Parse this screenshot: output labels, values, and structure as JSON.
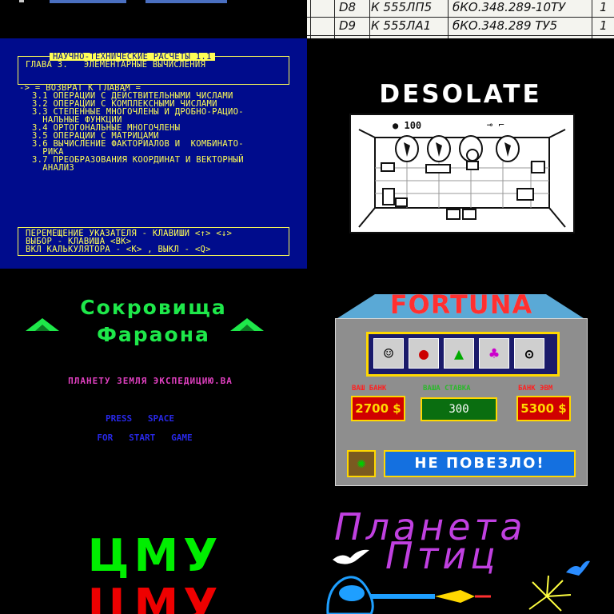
{
  "colors": {
    "calc_bg": "#000c8c",
    "calc_fg": "#ffff55",
    "pharaoh_green": "#1ee84a",
    "magenta": "#e040c0",
    "blue": "#2828e8",
    "fortuna_red": "#ff3030",
    "cmu_green": "#00ee00",
    "cmu_red": "#ee0000",
    "birds_magenta": "#c040e0"
  },
  "table_scan": {
    "rows": [
      {
        "ref": "D8",
        "part": "К 555ЛП5",
        "doc": "бКО.348.289-10ТУ",
        "qty": "1"
      },
      {
        "ref": "D9",
        "part": "К 555ЛА1",
        "doc": "бКО.348.289 ТУ5",
        "qty": "1"
      }
    ]
  },
  "calc_menu": {
    "title": "НАУЧНО-ТЕХНИЧЕСКИЕ РАСЧЕТЫ 1.1",
    "chapter": "ГЛАВА 3.   ЭЛЕМЕНТАРНЫЕ ВЫЧИСЛЕНИЯ",
    "back_item": "-> = ВОЗВРАТ К ГЛАВАМ =",
    "items": [
      "3.1 ОПЕРАЦИИ С ДЕЙСТВИТЕЛЬНЫМИ ЧИСЛАМИ",
      "3.2 ОПЕРАЦИИ С КОМПЛЕКСНЫМИ ЧИСЛАМИ",
      "3.3 СТЕПЕННЫЕ МНОГОЧЛЕНЫ И ДРОБНО-РАЦИО-\n  НАЛЬНЫЕ ФУНКЦИИ",
      "3.4 ОРТОГОНАЛЬНЫЕ МНОГОЧЛЕНЫ",
      "3.5 ОПЕРАЦИИ С МАТРИЦАМИ",
      "3.6 ВЫЧИСЛЕНИЕ ФАКТОРИАЛОВ И  КОМБИНАТО-\n  РИКА",
      "3.7 ПРЕОБРАЗОВАНИЯ КООРДИНАТ И ВЕКТОРНЫЙ\n  АНАЛИЗ"
    ],
    "help_lines": [
      "ПЕРЕМЕЩЕНИЕ УКАЗАТЕЛЯ - КЛАВИШИ <↑> <↓>",
      "ВЫБОР - КЛАВИША <ВК>",
      "ВКЛ КАЛЬКУЛЯТОРА - <К> , ВЫКЛ - <Q>"
    ]
  },
  "desolate": {
    "logo": "DESOLATE",
    "score": "100",
    "score_icon": "coin-icon",
    "tool_icons": [
      "key-icon",
      "gun-icon"
    ]
  },
  "pharaoh": {
    "title_line1": "Сокровища",
    "title_line2": "Фараона",
    "credit": "ПЛАНЕТУ ЗЕМЛЯ ЭКСПЕДИЦИЮ.ВА",
    "prompt_line1": "PRESS   SPACE",
    "prompt_line2": "FOR   START   GAME"
  },
  "fortuna": {
    "title": "FORTUNA",
    "reel_icons": [
      "clown-icon",
      "bomb-icon",
      "tree-icon",
      "jester-icon",
      "bear-icon"
    ],
    "bank_label": "ВАШ БАНК",
    "bank_value": "2700 $",
    "bet_label": "ВАША СТАВКА",
    "bet_value": "300",
    "computer_label": "БАНК ЭВМ",
    "computer_value": "5300 $",
    "message": "НЕ ПОВЕЗЛО!",
    "avatar_icon": "parrot-icon"
  },
  "cmu": {
    "word_top": "ЦМУ",
    "word_bottom": "ЦМУ"
  },
  "birds": {
    "line1": "Планета",
    "line2": "Птиц"
  }
}
